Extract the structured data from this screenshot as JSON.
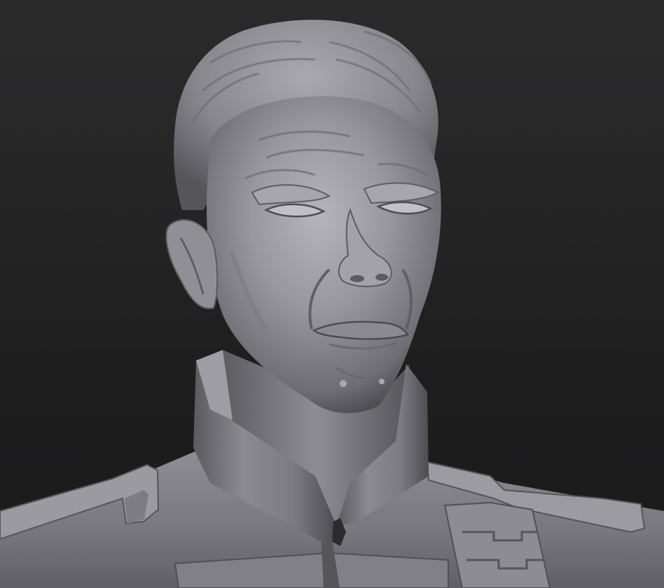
{
  "canvas": {
    "background_top": "#2b2b2c",
    "background_bottom": "#1a1a1b"
  },
  "model": {
    "material": "matcap-gray-clay",
    "base_color": "#8a8a90",
    "highlight_color": "#b6b6bc",
    "shadow_color": "#3a3a3f",
    "subject": "sculpted-bust-uniform-high-collar"
  }
}
